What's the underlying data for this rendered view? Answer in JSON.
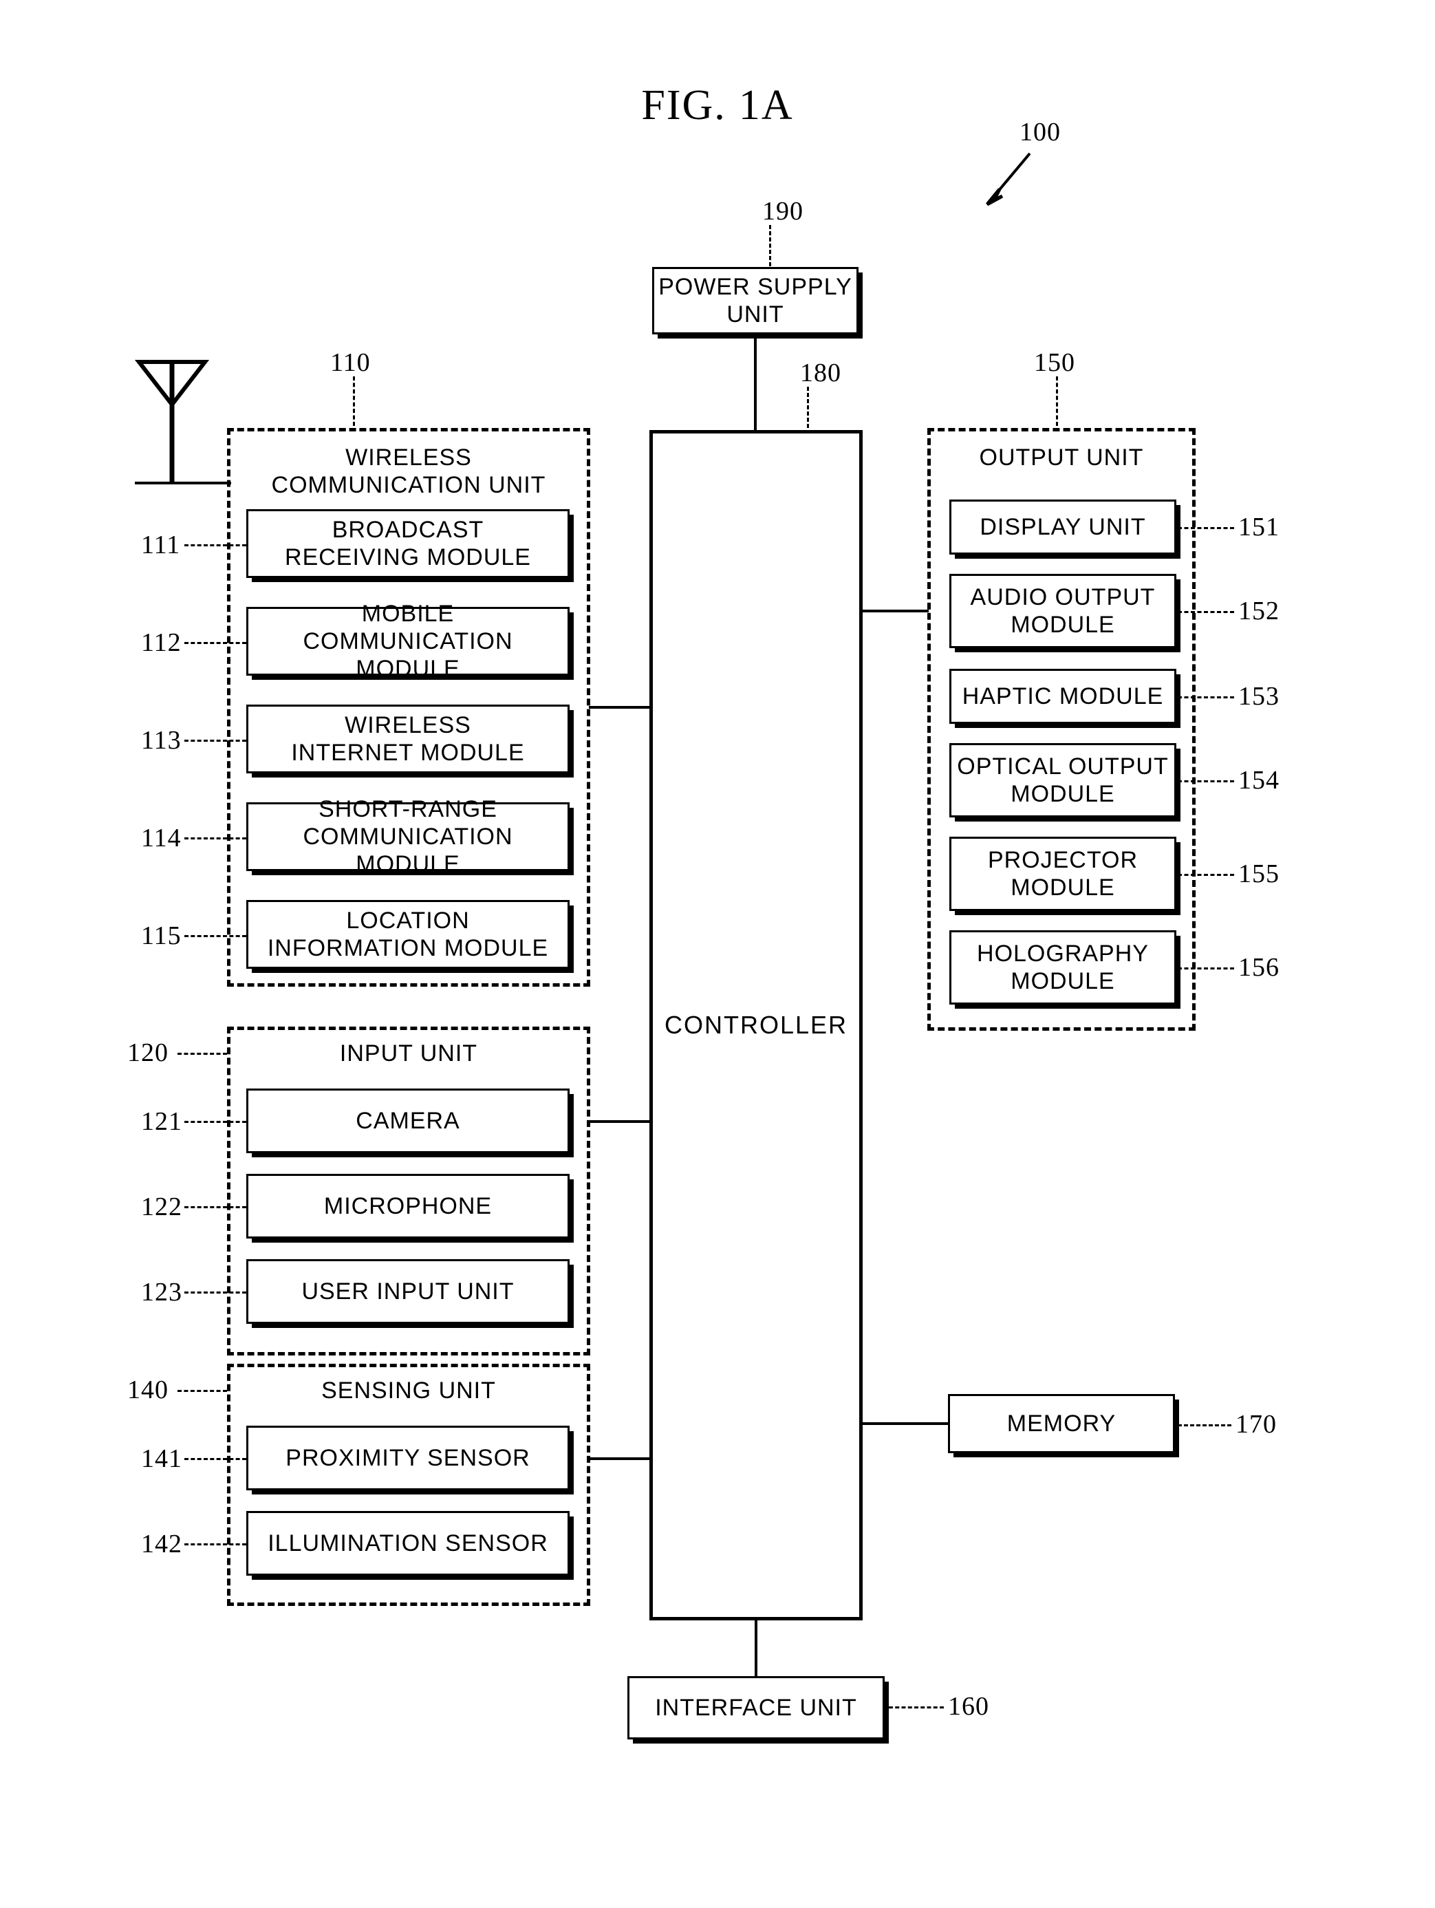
{
  "figure": {
    "title_prefix": "FIG.",
    "title_number": "1A",
    "device_ref": "100"
  },
  "power_supply": {
    "label": "POWER SUPPLY\nUNIT",
    "ref": "190"
  },
  "controller": {
    "label": "CONTROLLER",
    "ref": "180"
  },
  "wireless_communication_unit": {
    "title": "WIRELESS\nCOMMUNICATION UNIT",
    "ref": "110",
    "modules": [
      {
        "ref": "111",
        "label": "BROADCAST\nRECEIVING MODULE"
      },
      {
        "ref": "112",
        "label": "MOBILE\nCOMMUNICATION MODULE"
      },
      {
        "ref": "113",
        "label": "WIRELESS\nINTERNET MODULE"
      },
      {
        "ref": "114",
        "label": "SHORT-RANGE\nCOMMUNICATION MODULE"
      },
      {
        "ref": "115",
        "label": "LOCATION\nINFORMATION MODULE"
      }
    ]
  },
  "input_unit": {
    "title": "INPUT UNIT",
    "ref": "120",
    "modules": [
      {
        "ref": "121",
        "label": "CAMERA"
      },
      {
        "ref": "122",
        "label": "MICROPHONE"
      },
      {
        "ref": "123",
        "label": "USER INPUT UNIT"
      }
    ]
  },
  "sensing_unit": {
    "title": "SENSING UNIT",
    "ref": "140",
    "modules": [
      {
        "ref": "141",
        "label": "PROXIMITY SENSOR"
      },
      {
        "ref": "142",
        "label": "ILLUMINATION SENSOR"
      }
    ]
  },
  "output_unit": {
    "title": "OUTPUT UNIT",
    "ref": "150",
    "modules": [
      {
        "ref": "151",
        "label": "DISPLAY UNIT"
      },
      {
        "ref": "152",
        "label": "AUDIO OUTPUT\nMODULE"
      },
      {
        "ref": "153",
        "label": "HAPTIC MODULE"
      },
      {
        "ref": "154",
        "label": "OPTICAL OUTPUT\nMODULE"
      },
      {
        "ref": "155",
        "label": "PROJECTOR\nMODULE"
      },
      {
        "ref": "156",
        "label": "HOLOGRAPHY\nMODULE"
      }
    ]
  },
  "memory": {
    "label": "MEMORY",
    "ref": "170"
  },
  "interface_unit": {
    "label": "INTERFACE UNIT",
    "ref": "160"
  },
  "icons": {
    "antenna": "antenna-icon",
    "pointer_arrow": "arrow-icon"
  }
}
